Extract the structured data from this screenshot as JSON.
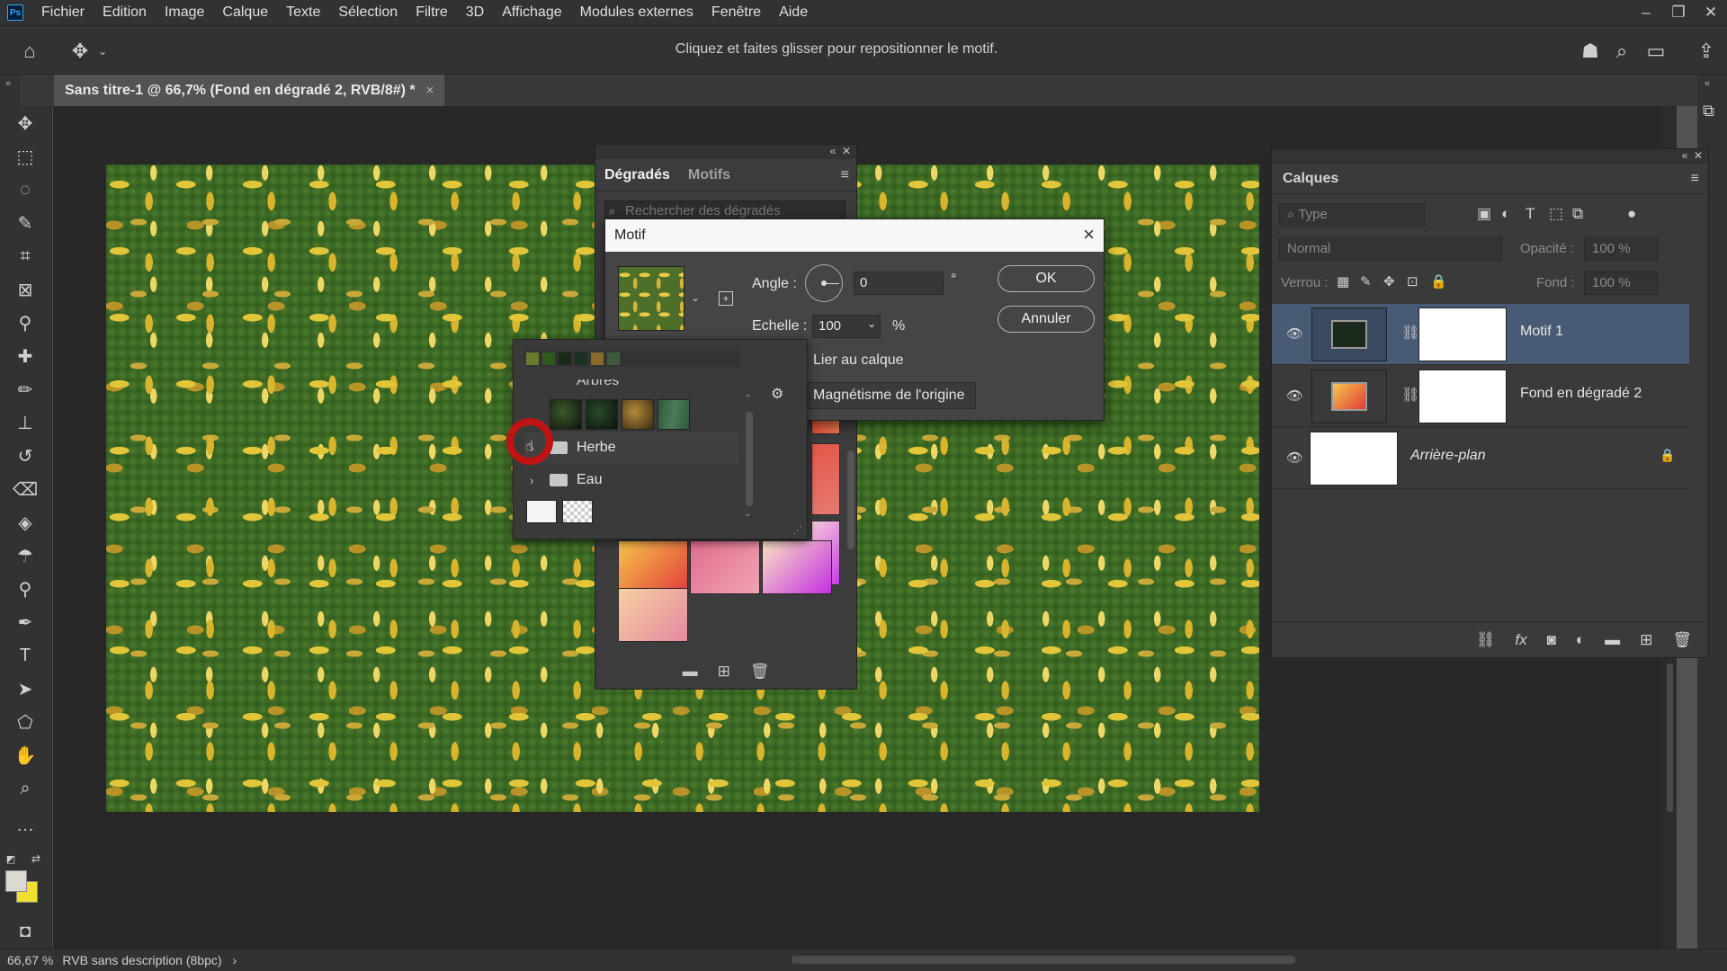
{
  "app": {
    "logo_text": "Ps"
  },
  "menu": [
    "Fichier",
    "Edition",
    "Image",
    "Calque",
    "Texte",
    "Sélection",
    "Filtre",
    "3D",
    "Affichage",
    "Modules externes",
    "Fenêtre",
    "Aide"
  ],
  "window_controls": {
    "minimize": "–",
    "restore": "❐",
    "close": "✕"
  },
  "options_bar": {
    "hint": "Cliquez et faites glisser pour repositionner le motif."
  },
  "document_tab": {
    "title": "Sans titre-1 @ 66,7% (Fond en dégradé 2, RVB/8#) *",
    "close": "×"
  },
  "status_bar": {
    "zoom": "66,67 %",
    "info": "RVB sans description (8bpc)",
    "arrow": "›"
  },
  "gradients_panel": {
    "tabs": [
      "Dégradés",
      "Motifs"
    ],
    "search_placeholder": "Rechercher des dégradés"
  },
  "motif_dialog": {
    "title": "Motif",
    "angle_label": "Angle :",
    "angle_value": "0",
    "angle_unit": "°",
    "scale_label": "Echelle :",
    "scale_value": "100",
    "scale_unit": "%",
    "link_label": "Lier au calque",
    "snap_button": "Magnétisme de l'origine",
    "ok": "OK",
    "cancel": "Annuler"
  },
  "pattern_picker": {
    "partial_folder": "Arbres",
    "folders": [
      "Herbe",
      "Eau"
    ]
  },
  "layers_panel": {
    "title": "Calques",
    "filter_placeholder": "Type",
    "blend_mode": "Normal",
    "opacity_label": "Opacité :",
    "opacity_value": "100 %",
    "lock_label": "Verrou :",
    "fill_label": "Fond :",
    "fill_value": "100 %",
    "layers": [
      {
        "name": "Motif 1",
        "selected": true
      },
      {
        "name": "Fond en dégradé 2",
        "selected": false
      },
      {
        "name": "Arrière-plan",
        "selected": false
      }
    ]
  },
  "colors": {
    "selection": "#495a74",
    "foreground": "#dcdad0",
    "background": "#f2e02e",
    "cursor_ring": "#c01414"
  }
}
